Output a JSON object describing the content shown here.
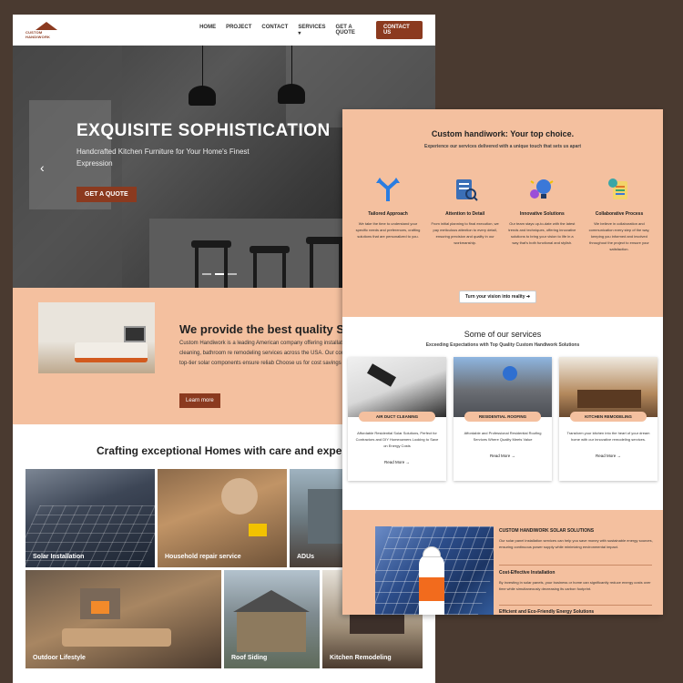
{
  "nav": {
    "logo_text": "CUSTOM HANDIWORK",
    "links": [
      "HOME",
      "PROJECT",
      "CONTACT",
      "SERVICES",
      "GET A QUOTE"
    ],
    "contact_btn": "CONTACT US"
  },
  "hero": {
    "title": "EXQUISITE SOPHISTICATION",
    "subtitle": "Handcrafted Kitchen Furniture for Your Home's Finest Expression",
    "cta": "GET A QUOTE"
  },
  "about": {
    "title": "We provide the best quality Se",
    "text": "Custom Handiwork is a leading American company offering installation, siding, roofing, air duct cleaning, bathroom re remodeling services across the USA. Our commitment to a winning team, and top-tier solar components ensure reliab Choose us for cost savings and a greener future.",
    "btn": "Learn more"
  },
  "crafting": {
    "title": "Crafting exceptional Homes with care and expertis",
    "tiles": [
      "Solar Installation",
      "Household repair service",
      "ADUs",
      "Outdoor Lifestyle",
      "Roof Siding",
      "Kitchen Remodeling"
    ]
  },
  "right": {
    "title": "Custom handiwork: Your top choice.",
    "subtitle": "Experience our services delivered with a unique touch that sets us apart",
    "features": [
      {
        "title": "Tailored Approach",
        "text": "We take the time to understand your specific needs and preferences, crafting solutions that are personalized to you."
      },
      {
        "title": "Attention to Detail",
        "text": "From initial planning to final execution, we pay meticulous attention to every detail, ensuring precision and quality in our workmanship."
      },
      {
        "title": "Innovative Solutions",
        "text": "Our team stays up-to-date with the latest trends and techniques, offering innovative solutions to bring your vision to life in a way that's both functional and stylish."
      },
      {
        "title": "Collaborative Process",
        "text": "We believe in collaboration and communication every step of the way, keeping you informed and involved throughout the project to ensure your satisfaction."
      }
    ],
    "vision_btn": "Turn your vision into reality",
    "services_title": "Some of our services",
    "services_sub": "Exceeding Expectations with Top Quality Custom Handiwork Solutions",
    "services": [
      {
        "badge": "AIR DUCT CLEANING",
        "text": "Affordable Residential Solar Solutions, Perfect for Contractors and DIY Homeowners Looking to Save on Energy Costs",
        "link": "Read More →"
      },
      {
        "badge": "RESIDENTIAL ROOFING",
        "text": "Affordable and Professional Residential Roofing Services Where Quality Meets Value",
        "link": "Read More →"
      },
      {
        "badge": "KITCHEN REMODELING",
        "text": "Transform your kitchen into the heart of your dream home with our innovative remodeling services.",
        "link": "Read More →"
      }
    ],
    "solar_title": "CUSTOM HANDIWORK SOLAR SOLUTIONS",
    "solar_text": "Our solar panel installation services can help you save money with sustainable energy sources, ensuring continuous power supply while minimizing environmental impact.",
    "cost_title": "Cost-Effective Installation",
    "cost_text": "By investing in solar panels, your business or home can significantly reduce energy costs over time while simultaneously decreasing its carbon footprint.",
    "eco_title": "Efficient and Eco-Friendly Energy Solutions"
  }
}
